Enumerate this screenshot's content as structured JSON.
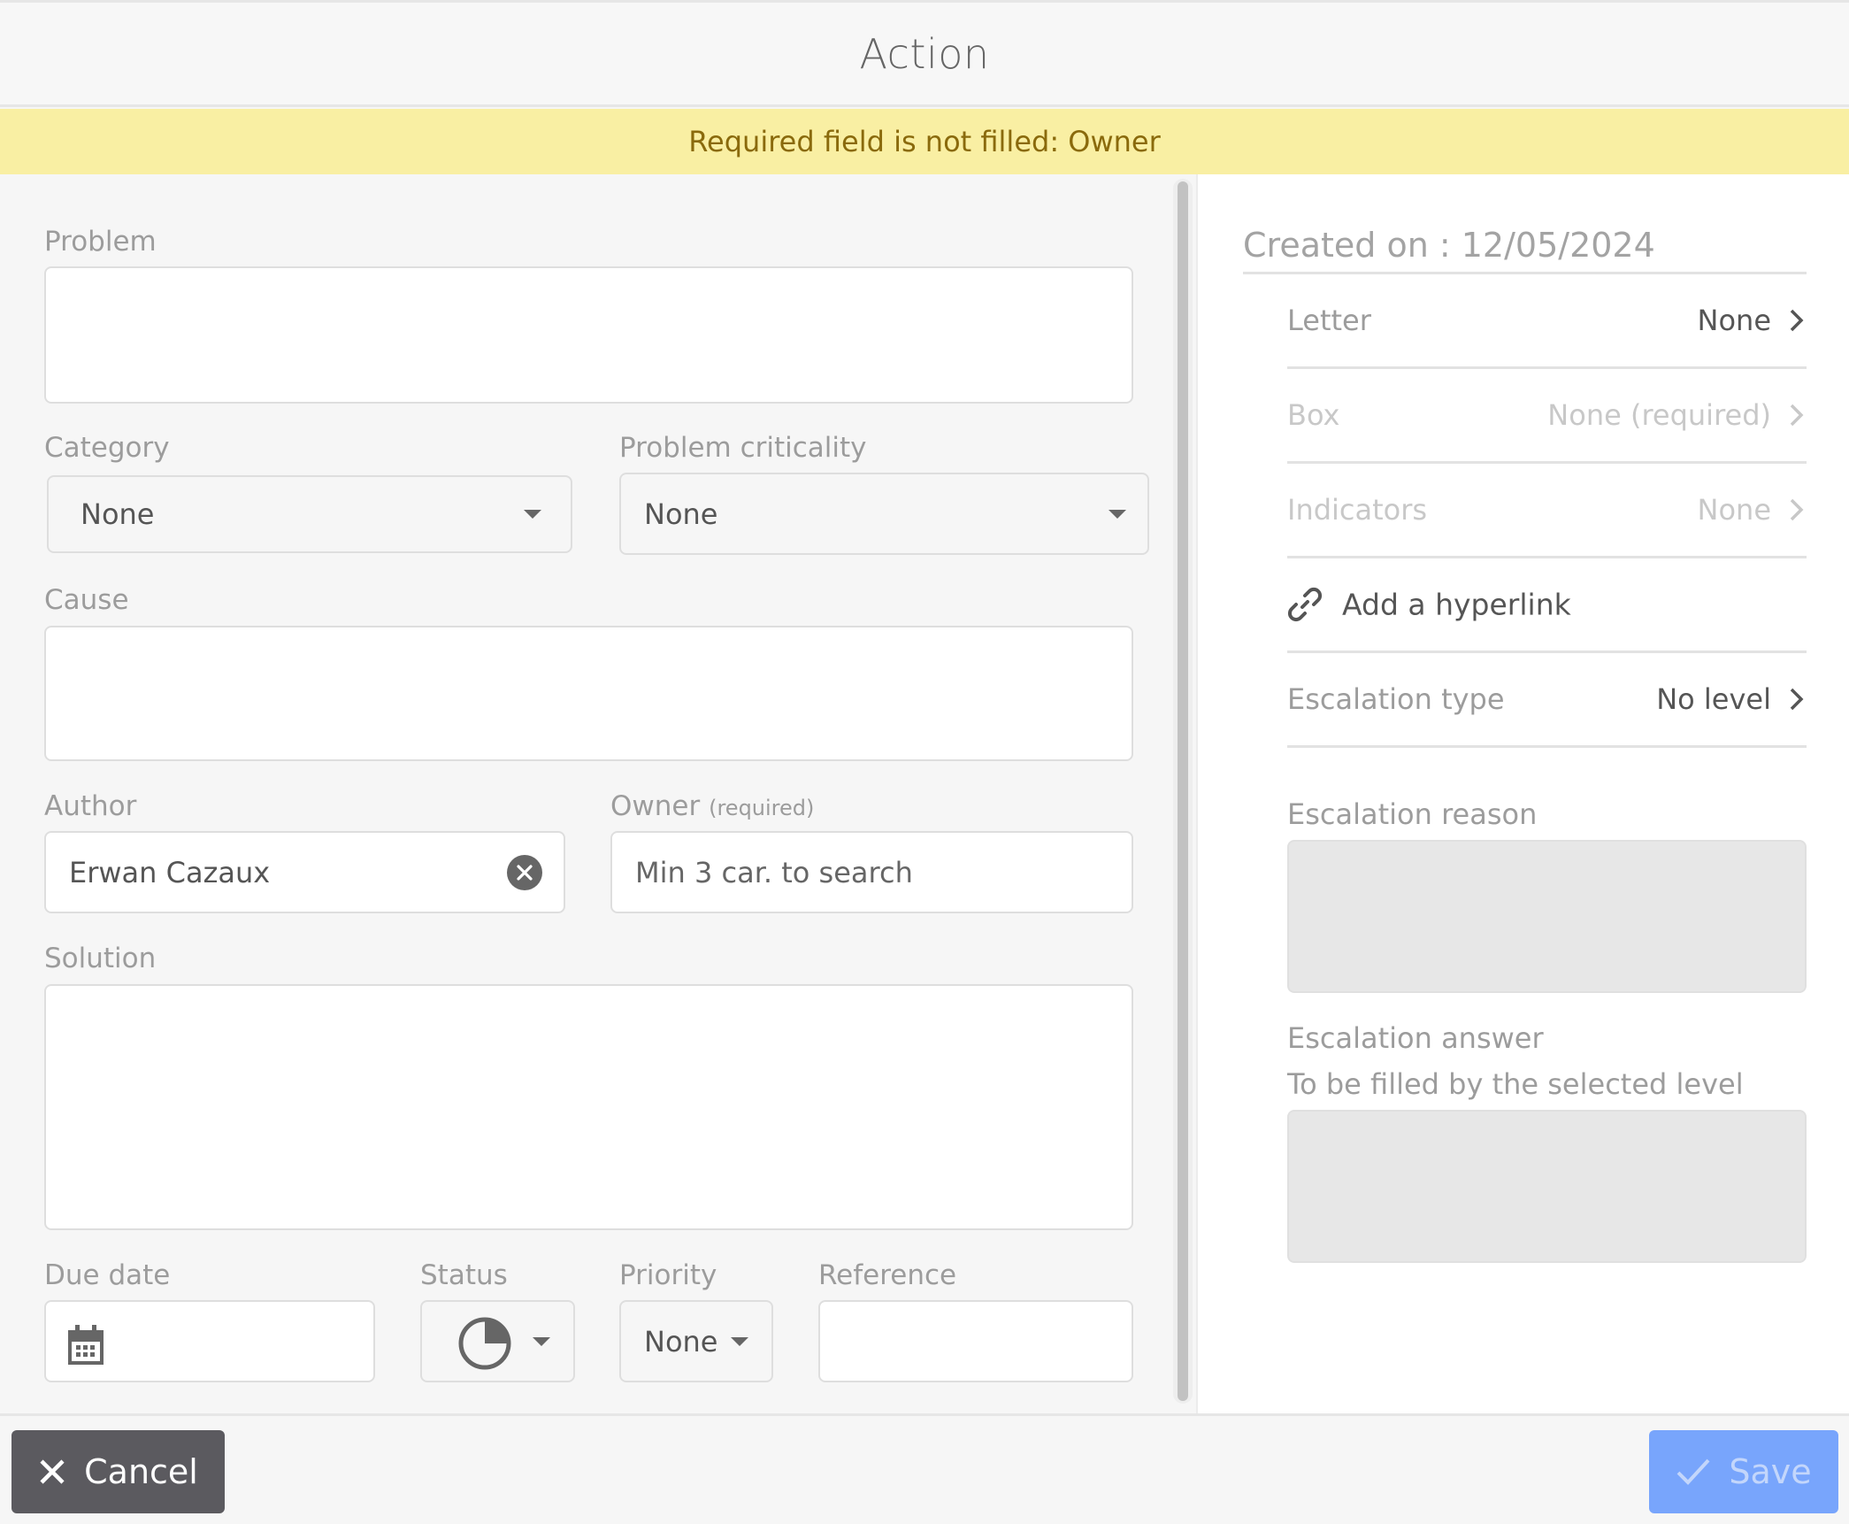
{
  "header": {
    "title": "Action"
  },
  "banner": {
    "message": "Required field is not filled: Owner",
    "color": "#f9efa3"
  },
  "form": {
    "problem": {
      "label": "Problem",
      "value": ""
    },
    "category": {
      "label": "Category",
      "selected": "None"
    },
    "problem_criticality": {
      "label": "Problem criticality",
      "selected": "None"
    },
    "cause": {
      "label": "Cause",
      "value": ""
    },
    "author": {
      "label": "Author",
      "value": "Erwan Cazaux"
    },
    "owner": {
      "label": "Owner",
      "required_note": "(required)",
      "placeholder": "Min 3 car. to search",
      "value": ""
    },
    "solution": {
      "label": "Solution",
      "value": ""
    },
    "due_date": {
      "label": "Due date",
      "value": "",
      "icon": "calendar-icon"
    },
    "status": {
      "label": "Status",
      "icon": "status-pie-icon"
    },
    "priority": {
      "label": "Priority",
      "selected": "None"
    },
    "reference": {
      "label": "Reference",
      "value": ""
    }
  },
  "side": {
    "created_on": "Created on : 12/05/2024",
    "rows": [
      {
        "label": "Letter",
        "value": "None",
        "state": "active"
      },
      {
        "label": "Box",
        "value": "None (required)",
        "state": "disabled"
      },
      {
        "label": "Indicators",
        "value": "None",
        "state": "disabled"
      }
    ],
    "hyperlink_label": "Add a hyperlink",
    "escalation_type": {
      "label": "Escalation type",
      "value": "No level"
    },
    "escalation_reason": {
      "label": "Escalation reason",
      "value": ""
    },
    "escalation_answer": {
      "label": "Escalation answer",
      "hint": "To be filled by the selected level",
      "value": ""
    }
  },
  "footer": {
    "cancel_label": "Cancel",
    "save_label": "Save",
    "cancel_color": "#5b5a5f",
    "save_color": "#78a5fc"
  }
}
